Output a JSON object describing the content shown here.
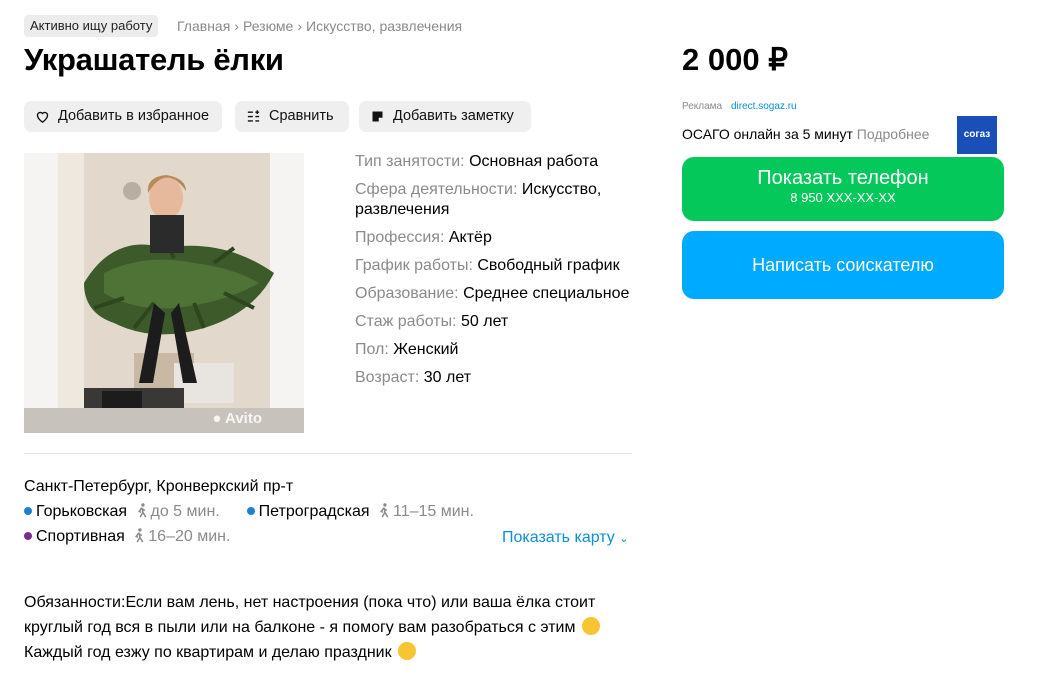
{
  "badge": "Активно ищу работу",
  "breadcrumbs": [
    "Главная",
    "Резюме",
    "Искусство, развлечения"
  ],
  "title": "Украшатель ёлки",
  "actions": {
    "favorite": "Добавить в избранное",
    "compare": "Сравнить",
    "note": "Добавить заметку"
  },
  "photo": {
    "watermark": "Avito"
  },
  "params": [
    {
      "key": "Тип занятости:",
      "value": "Основная работа"
    },
    {
      "key": "Сфера деятельности:",
      "value": "Искусство, развлечения"
    },
    {
      "key": "Профессия:",
      "value": "Актёр"
    },
    {
      "key": "График работы:",
      "value": "Свободный график"
    },
    {
      "key": "Образование:",
      "value": "Среднее специальное"
    },
    {
      "key": "Стаж работы:",
      "value": "50 лет"
    },
    {
      "key": "Пол:",
      "value": "Женский"
    },
    {
      "key": "Возраст:",
      "value": "30 лет"
    }
  ],
  "location": {
    "address": "Санкт-Петербург, Кронверкский пр-т",
    "metro": [
      {
        "name": "Горьковская",
        "time": "до 5 мин.",
        "color": "#1f7fd6"
      },
      {
        "name": "Петроградская",
        "time": "11–15 мин.",
        "color": "#1f7fd6"
      },
      {
        "name": "Спортивная",
        "time": "16–20 мин.",
        "color": "#7a2d8f"
      }
    ],
    "show_map": "Показать карту"
  },
  "description": {
    "line1": "Обязанности:Если вам лень, нет настроения (пока что) или ваша ёлка стоит",
    "line2": "круглый год вся в пыли или на балконе - я помогу вам разобраться с этим",
    "line3": "Каждый год езжу по квартирам и делаю праздник"
  },
  "sidebar": {
    "price": "2 000 ₽",
    "ad_label": "Реклама",
    "ad_domain": "direct.sogaz.ru",
    "ad_text": "ОСАГО онлайн за 5 минут",
    "ad_more": "Подробнее",
    "ad_logo": "согаз",
    "phone_button": "Показать телефон",
    "phone_masked": "8 950 XXX-XX-XX",
    "write_button": "Написать соискателю"
  },
  "colors": {
    "green": "#04c85a",
    "blue": "#00aaff",
    "link": "#0a8fd8"
  }
}
